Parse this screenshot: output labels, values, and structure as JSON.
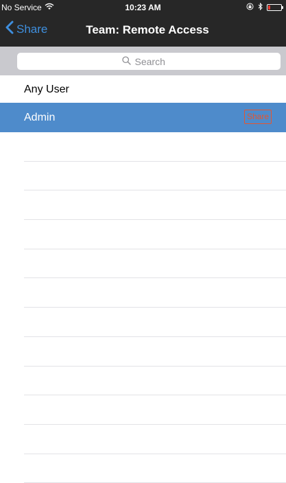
{
  "status_bar": {
    "carrier": "No Service",
    "time": "10:23 AM",
    "battery_fraction": 0.18
  },
  "navbar": {
    "back_label": "Share",
    "title": "Team: Remote Access"
  },
  "search": {
    "placeholder": "Search"
  },
  "rows": [
    {
      "label": "Any User",
      "selected": false
    },
    {
      "label": "Admin",
      "selected": true,
      "badge": "Share"
    }
  ],
  "colors": {
    "nav_background": "#272727",
    "accent": "#3f8fde",
    "selected_row": "#4e8bcb",
    "badge": "#e8542c"
  },
  "icons": {
    "wifi": "wifi-icon",
    "back": "chevron-left-icon",
    "search": "magnifier-icon",
    "orientation_lock": "orientation-lock-icon",
    "bluetooth": "bluetooth-icon",
    "battery": "battery-icon"
  }
}
